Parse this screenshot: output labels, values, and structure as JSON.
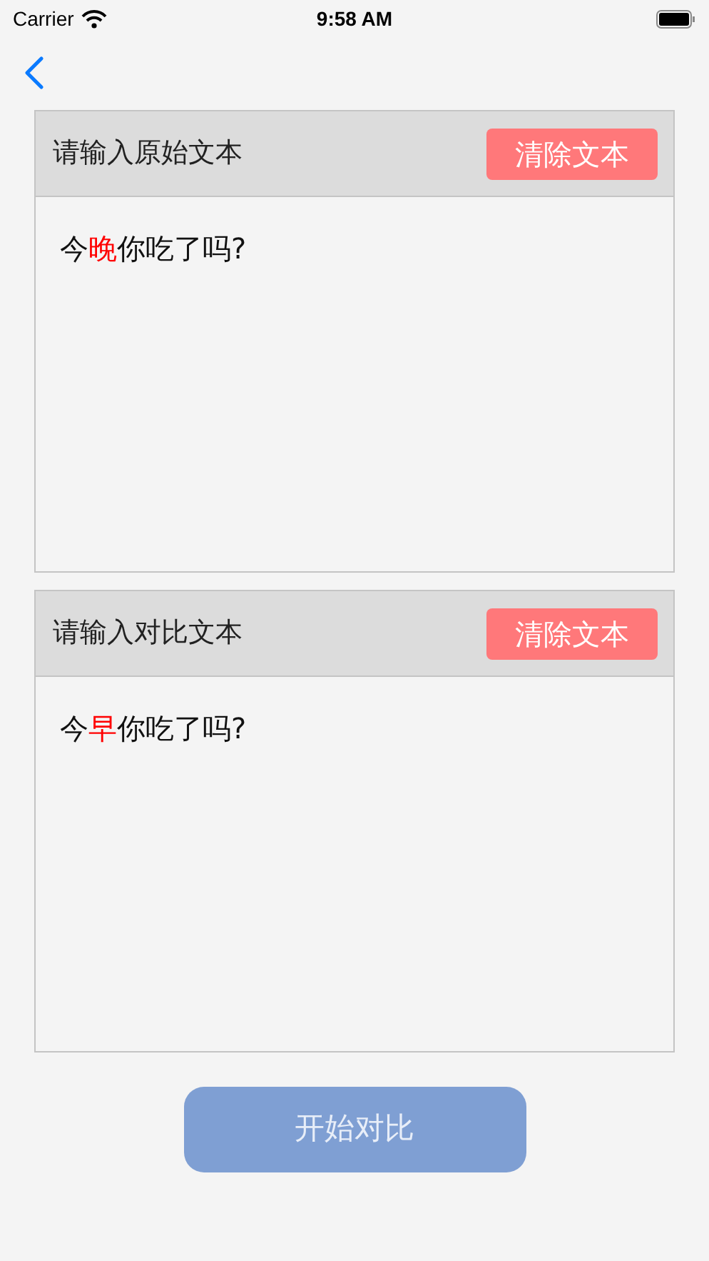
{
  "status_bar": {
    "carrier": "Carrier",
    "time": "9:58 AM"
  },
  "panels": [
    {
      "title": "请输入原始文本",
      "clear_button": "清除文本",
      "segments": [
        {
          "text": "今",
          "changed": false
        },
        {
          "text": "晚",
          "changed": true
        },
        {
          "text": "你吃了吗?",
          "changed": false
        }
      ]
    },
    {
      "title": "请输入对比文本",
      "clear_button": "清除文本",
      "segments": [
        {
          "text": "今",
          "changed": false
        },
        {
          "text": "早",
          "changed": true
        },
        {
          "text": "你吃了吗?",
          "changed": false
        }
      ]
    }
  ],
  "compare_button": {
    "label": "开始对比",
    "disabled": true
  }
}
